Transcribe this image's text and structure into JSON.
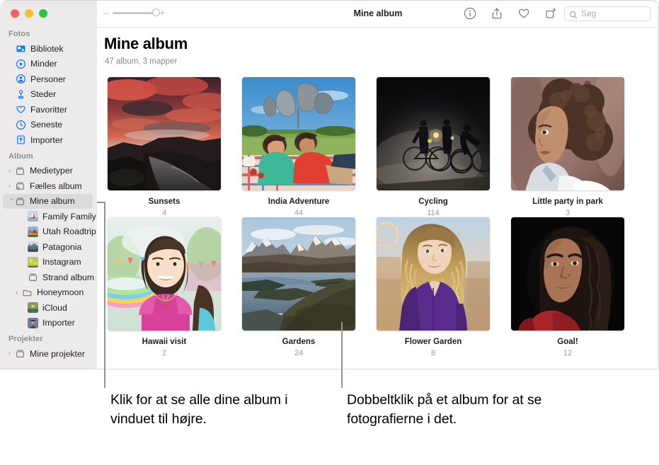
{
  "window": {
    "title": "Mine album",
    "traffic_lights": [
      "close",
      "minimize",
      "zoom"
    ]
  },
  "toolbar": {
    "zoom_minus": "–",
    "zoom_plus": "+",
    "zoom_level": 100,
    "info_icon": "info-icon",
    "share_icon": "share-icon",
    "favorite_icon": "heart-icon",
    "rotate_icon": "rotate-icon",
    "search_placeholder": "Søg",
    "search_value": ""
  },
  "sidebar": {
    "sections": [
      {
        "title": "Fotos",
        "items": [
          {
            "label": "Bibliotek",
            "icon": "library-icon",
            "chevron": "none",
            "indent": 1,
            "selected": false
          },
          {
            "label": "Minder",
            "icon": "memories-icon",
            "chevron": "none",
            "indent": 1,
            "selected": false
          },
          {
            "label": "Personer",
            "icon": "people-icon",
            "chevron": "none",
            "indent": 1,
            "selected": false
          },
          {
            "label": "Steder",
            "icon": "places-icon",
            "chevron": "none",
            "indent": 1,
            "selected": false
          },
          {
            "label": "Favoritter",
            "icon": "heart-icon",
            "chevron": "none",
            "indent": 1,
            "selected": false
          },
          {
            "label": "Seneste",
            "icon": "clock-icon",
            "chevron": "none",
            "indent": 1,
            "selected": false
          },
          {
            "label": "Importer",
            "icon": "import-icon",
            "chevron": "none",
            "indent": 1,
            "selected": false
          }
        ]
      },
      {
        "title": "Album",
        "items": [
          {
            "label": "Medietyper",
            "icon": "album-icon",
            "chevron": "right",
            "indent": 0,
            "selected": false
          },
          {
            "label": "Fælles album",
            "icon": "shared-album-icon",
            "chevron": "right",
            "indent": 0,
            "selected": false
          },
          {
            "label": "Mine album",
            "icon": "album-icon",
            "chevron": "down",
            "indent": 0,
            "selected": true
          },
          {
            "label": "Family Family…",
            "icon": "photo-thumb-sail",
            "chevron": "none",
            "indent": 2,
            "selected": false
          },
          {
            "label": "Utah Roadtrip",
            "icon": "photo-thumb-utah",
            "chevron": "none",
            "indent": 2,
            "selected": false
          },
          {
            "label": "Patagonia",
            "icon": "photo-thumb-pata",
            "chevron": "none",
            "indent": 2,
            "selected": false
          },
          {
            "label": "Instagram",
            "icon": "photo-thumb-insta",
            "chevron": "none",
            "indent": 2,
            "selected": false
          },
          {
            "label": "Strand album",
            "icon": "album-icon",
            "chevron": "none",
            "indent": 2,
            "selected": false
          },
          {
            "label": "Honeymoon",
            "icon": "folder-icon",
            "chevron": "right",
            "indent": 1,
            "selected": false
          },
          {
            "label": "iCloud",
            "icon": "photo-thumb-kid",
            "chevron": "none",
            "indent": 2,
            "selected": false
          },
          {
            "label": "Importer",
            "icon": "photo-thumb-man",
            "chevron": "none",
            "indent": 2,
            "selected": false
          }
        ]
      },
      {
        "title": "Projekter",
        "items": [
          {
            "label": "Mine projekter",
            "icon": "album-icon",
            "chevron": "right",
            "indent": 0,
            "selected": false
          }
        ]
      }
    ]
  },
  "main": {
    "title": "Mine album",
    "subtitle": "47 album, 3 mapper",
    "albums": [
      {
        "name": "Sunsets",
        "count": "4",
        "thumb": "sunset-lake"
      },
      {
        "name": "India Adventure",
        "count": "44",
        "thumb": "kids-picnic"
      },
      {
        "name": "Cycling",
        "count": "114",
        "thumb": "night-cyclists"
      },
      {
        "name": "Little party in park",
        "count": "3",
        "thumb": "curly-woman"
      },
      {
        "name": "Hawaii visit",
        "count": "2",
        "thumb": "girl-pink"
      },
      {
        "name": "Gardens",
        "count": "24",
        "thumb": "patagonia-lake"
      },
      {
        "name": "Flower Garden",
        "count": "8",
        "thumb": "woman-purple"
      },
      {
        "name": "Goal!",
        "count": "12",
        "thumb": "woman-dark"
      }
    ]
  },
  "callouts": [
    {
      "id": "callout-left",
      "text": "Klik for at se alle dine album i vinduet til højre."
    },
    {
      "id": "callout-right",
      "text": "Dobbeltklik på et album for at se fotografierne i det."
    }
  ],
  "colors": {
    "accent": "#1478f0",
    "sidebar_bg": "#eceaea",
    "selected_bg": "#dcdada",
    "muted_text": "#8e8e93"
  }
}
